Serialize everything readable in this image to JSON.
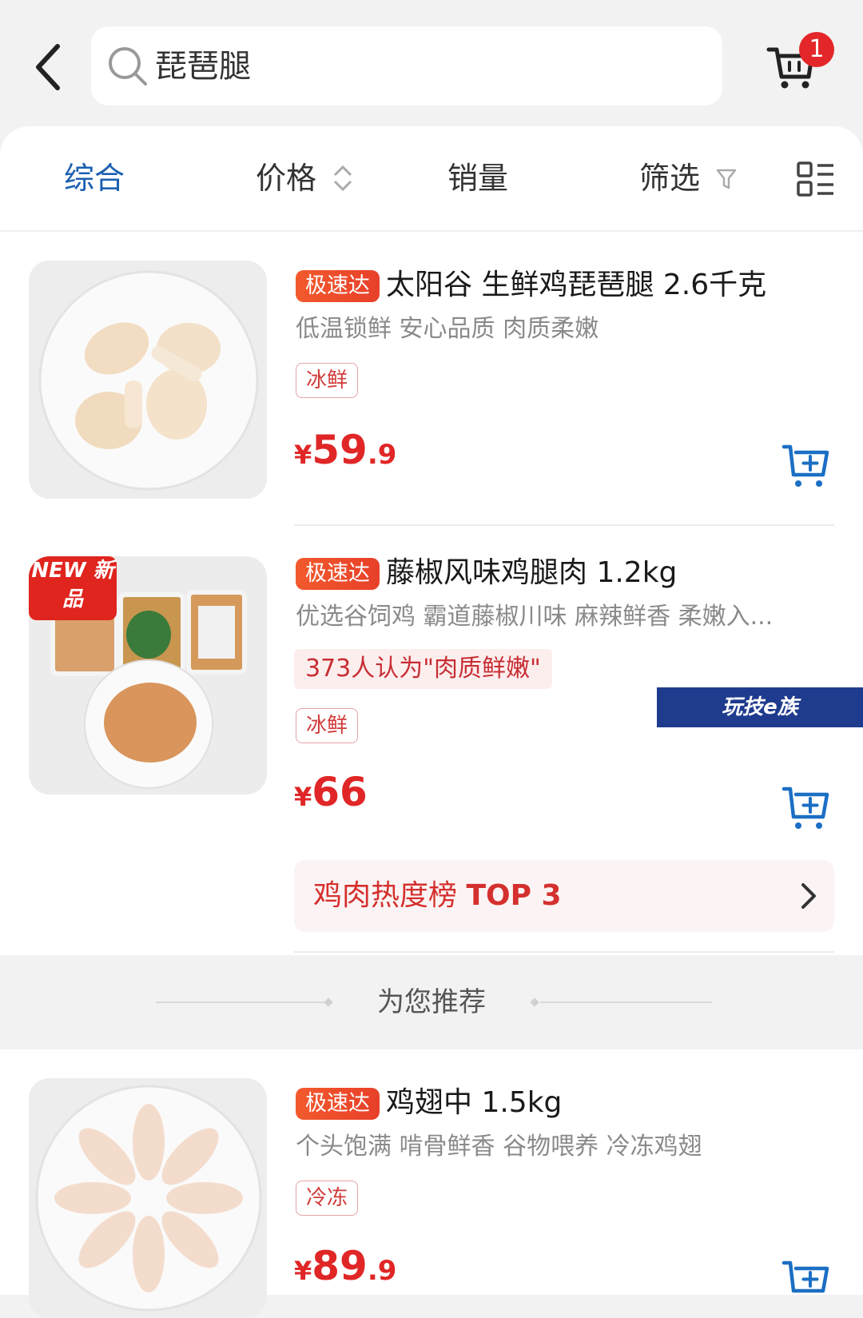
{
  "header": {
    "search_text": "琵琶腿",
    "cart_badge": "1"
  },
  "tabs": {
    "comprehensive": "综合",
    "price": "价格",
    "sales": "销量",
    "filter": "筛选"
  },
  "products": [
    {
      "tag": "极速达",
      "title": "太阳谷 生鲜鸡琵琶腿 2.6千克",
      "subtitle": "低温锁鲜 安心品质 肉质柔嫩",
      "chip": "冰鲜",
      "price_symbol": "¥",
      "price_int": "59",
      "price_dec": ".9"
    },
    {
      "badge": "NEW 新品",
      "tag": "极速达",
      "title": "藤椒风味鸡腿肉 1.2kg",
      "subtitle": "优选谷饲鸡 霸道藤椒川味 麻辣鲜香 柔嫩入...",
      "praise": "373人认为\"肉质鲜嫩\"",
      "chip": "冰鲜",
      "price_symbol": "¥",
      "price_int": "66",
      "price_dec": "",
      "rank_label": "鸡肉热度榜",
      "rank_top": "TOP 3"
    },
    {
      "tag": "极速达",
      "title": "鸡翅中 1.5kg",
      "subtitle": "个头饱满 啃骨鲜香 谷物喂养 冷冻鸡翅",
      "chip": "冷冻",
      "price_symbol": "¥",
      "price_int": "89",
      "price_dec": ".9"
    }
  ],
  "recommend": "为您推荐",
  "watermark": "玩技e族",
  "colors": {
    "accent_blue": "#1b5fb0",
    "price_red": "#e02626",
    "tag_orange": "#e8402a"
  }
}
